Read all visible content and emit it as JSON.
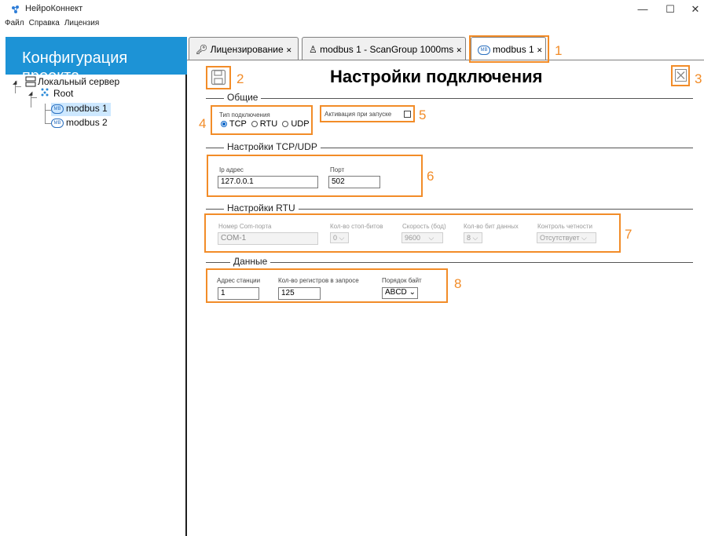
{
  "window": {
    "title": "НейроКоннект",
    "minimize": "—",
    "maximize": "☐",
    "close": "✕"
  },
  "menu": [
    "Файл",
    "Справка",
    "Лицензия"
  ],
  "left_panel": {
    "header": "Конфигурация проекта",
    "tree": {
      "server": "Локальный сервер",
      "root": "Root",
      "item1": "modbus 1",
      "item2": "modbus 2",
      "badge": "MB"
    }
  },
  "tabs": [
    {
      "label": "Лицензирование",
      "close": "✕",
      "icon": "key-icon"
    },
    {
      "label": "modbus 1 - ScanGroup 1000ms",
      "close": "✕",
      "icon": "group-icon"
    },
    {
      "label": "modbus 1",
      "close": "✕",
      "icon": "modbus-icon"
    }
  ],
  "markers": [
    "1",
    "2",
    "3",
    "4",
    "5",
    "6",
    "7",
    "8"
  ],
  "page": {
    "title": "Настройки подключения"
  },
  "general": {
    "group": "Общие",
    "conn_type_label": "Тип подключения",
    "options": [
      "TCP",
      "RTU",
      "UDP"
    ],
    "selected": "TCP",
    "autostart_label": "Активация при запуске",
    "autostart_checked": false
  },
  "tcp": {
    "group": "Настройки TCP/UDP",
    "ip_label": "Ip адрес",
    "ip_value": "127.0.0.1",
    "port_label": "Порт",
    "port_value": "502"
  },
  "rtu": {
    "group": "Настройки RTU",
    "com_label": "Номер Com-порта",
    "com_value": "COM-1",
    "stopbits_label": "Кол-во стоп-битов",
    "stopbits_value": "0",
    "speed_label": "Скорость (бод)",
    "speed_value": "9600",
    "databits_label": "Кол-во бит данных",
    "databits_value": "8",
    "parity_label": "Контроль четности",
    "parity_value": "Отсутствует"
  },
  "data": {
    "group": "Данные",
    "station_label": "Адрес станции",
    "station_value": "1",
    "regs_label": "Кол-во регистров в запросе",
    "regs_value": "125",
    "order_label": "Порядок байт",
    "order_value": "ABCD"
  },
  "colors": {
    "accent_blue": "#1d93d6",
    "marker_orange": "#f28c28",
    "selection": "#cde8ff"
  }
}
